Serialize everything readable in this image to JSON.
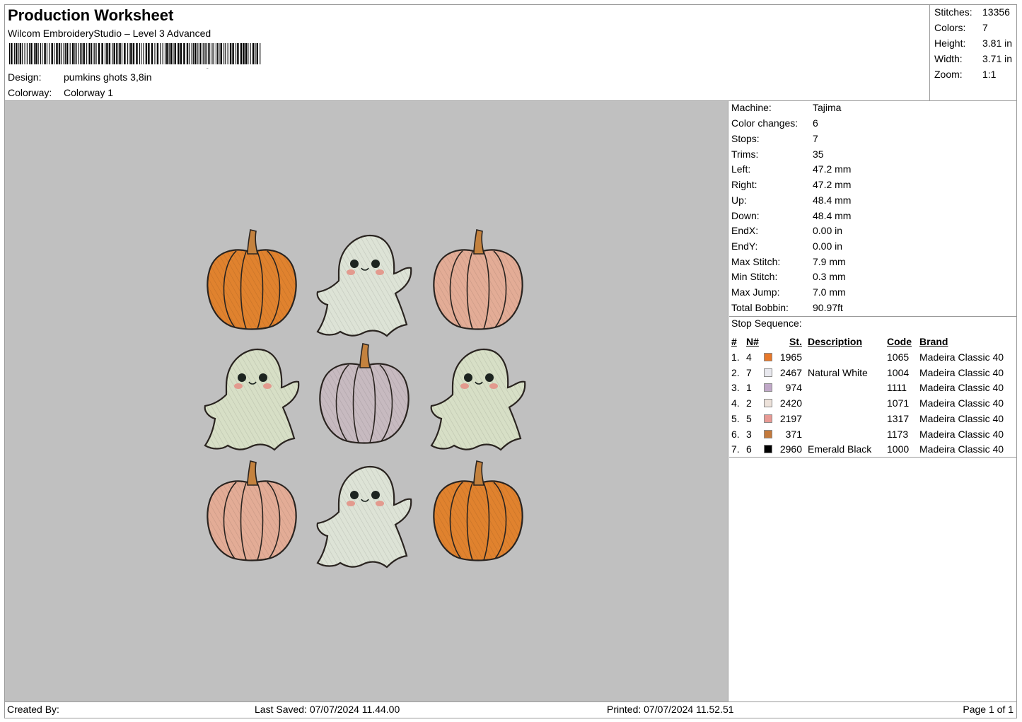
{
  "header": {
    "title": "Production Worksheet",
    "subtitle": "Wilcom EmbroideryStudio – Level 3 Advanced",
    "design_label": "Design:",
    "design_value": "pumkins ghots 3,8in",
    "colorway_label": "Colorway:",
    "colorway_value": "Colorway 1"
  },
  "summary": [
    {
      "k": "Stitches:",
      "v": "13356"
    },
    {
      "k": "Colors:",
      "v": "7"
    },
    {
      "k": "Height:",
      "v": "3.81 in"
    },
    {
      "k": "Width:",
      "v": "3.71 in"
    },
    {
      "k": "Zoom:",
      "v": "1:1"
    }
  ],
  "machine_info": [
    {
      "k": "Machine:",
      "v": "Tajima"
    },
    {
      "k": "Color changes:",
      "v": "6"
    },
    {
      "k": "Stops:",
      "v": "7"
    },
    {
      "k": "Trims:",
      "v": "35"
    },
    {
      "k": "Left:",
      "v": "47.2 mm"
    },
    {
      "k": "Right:",
      "v": "47.2 mm"
    },
    {
      "k": "Up:",
      "v": "48.4 mm"
    },
    {
      "k": "Down:",
      "v": "48.4 mm"
    },
    {
      "k": "EndX:",
      "v": "0.00 in"
    },
    {
      "k": "EndY:",
      "v": "0.00 in"
    },
    {
      "k": "Max Stitch:",
      "v": "7.9 mm"
    },
    {
      "k": "Min Stitch:",
      "v": "0.3 mm"
    },
    {
      "k": "Max Jump:",
      "v": "7.0 mm"
    },
    {
      "k": "Total Bobbin:",
      "v": "90.97ft"
    }
  ],
  "stop_sequence": {
    "label": "Stop Sequence:",
    "columns": {
      "num": "#",
      "n": "N#",
      "st": "St.",
      "desc": "Description",
      "code": "Code",
      "brand": "Brand"
    },
    "rows": [
      {
        "num": "1.",
        "n": "4",
        "color": "#e8782a",
        "st": "1965",
        "desc": "",
        "code": "1065",
        "brand": "Madeira Classic 40"
      },
      {
        "num": "2.",
        "n": "7",
        "color": "#e8e8ee",
        "st": "2467",
        "desc": "Natural White",
        "code": "1004",
        "brand": "Madeira Classic 40"
      },
      {
        "num": "3.",
        "n": "1",
        "color": "#c0a8c8",
        "st": "974",
        "desc": "",
        "code": "1111",
        "brand": "Madeira Classic 40"
      },
      {
        "num": "4.",
        "n": "2",
        "color": "#ede2da",
        "st": "2420",
        "desc": "",
        "code": "1071",
        "brand": "Madeira Classic 40"
      },
      {
        "num": "5.",
        "n": "5",
        "color": "#e89a94",
        "st": "2197",
        "desc": "",
        "code": "1317",
        "brand": "Madeira Classic 40"
      },
      {
        "num": "6.",
        "n": "3",
        "color": "#c47a3c",
        "st": "371",
        "desc": "",
        "code": "1173",
        "brand": "Madeira Classic 40"
      },
      {
        "num": "7.",
        "n": "6",
        "color": "#000000",
        "st": "2960",
        "desc": "Emerald Black",
        "code": "1000",
        "brand": "Madeira Classic 40"
      }
    ]
  },
  "footer": {
    "created_by": "Created By:",
    "last_saved": "Last Saved: 07/07/2024 11.44.00",
    "printed": "Printed: 07/07/2024 11.52.51",
    "page": "Page 1 of 1"
  },
  "design_grid": [
    [
      "pumpkin-orange",
      "ghost-mint",
      "pumpkin-peach"
    ],
    [
      "ghost-sage",
      "pumpkin-lilac",
      "ghost-sage"
    ],
    [
      "pumpkin-peach",
      "ghost-mint",
      "pumpkin-orange"
    ]
  ],
  "motif_colors": {
    "pumpkin-orange": "#e0822e",
    "pumpkin-peach": "#e3ac96",
    "pumpkin-lilac": "#c7bac0",
    "ghost-mint": "#dde3d6",
    "ghost-sage": "#d7dfc6",
    "stem": "#c4823e",
    "outline": "#2a2420",
    "blush": "#e39a8e"
  }
}
